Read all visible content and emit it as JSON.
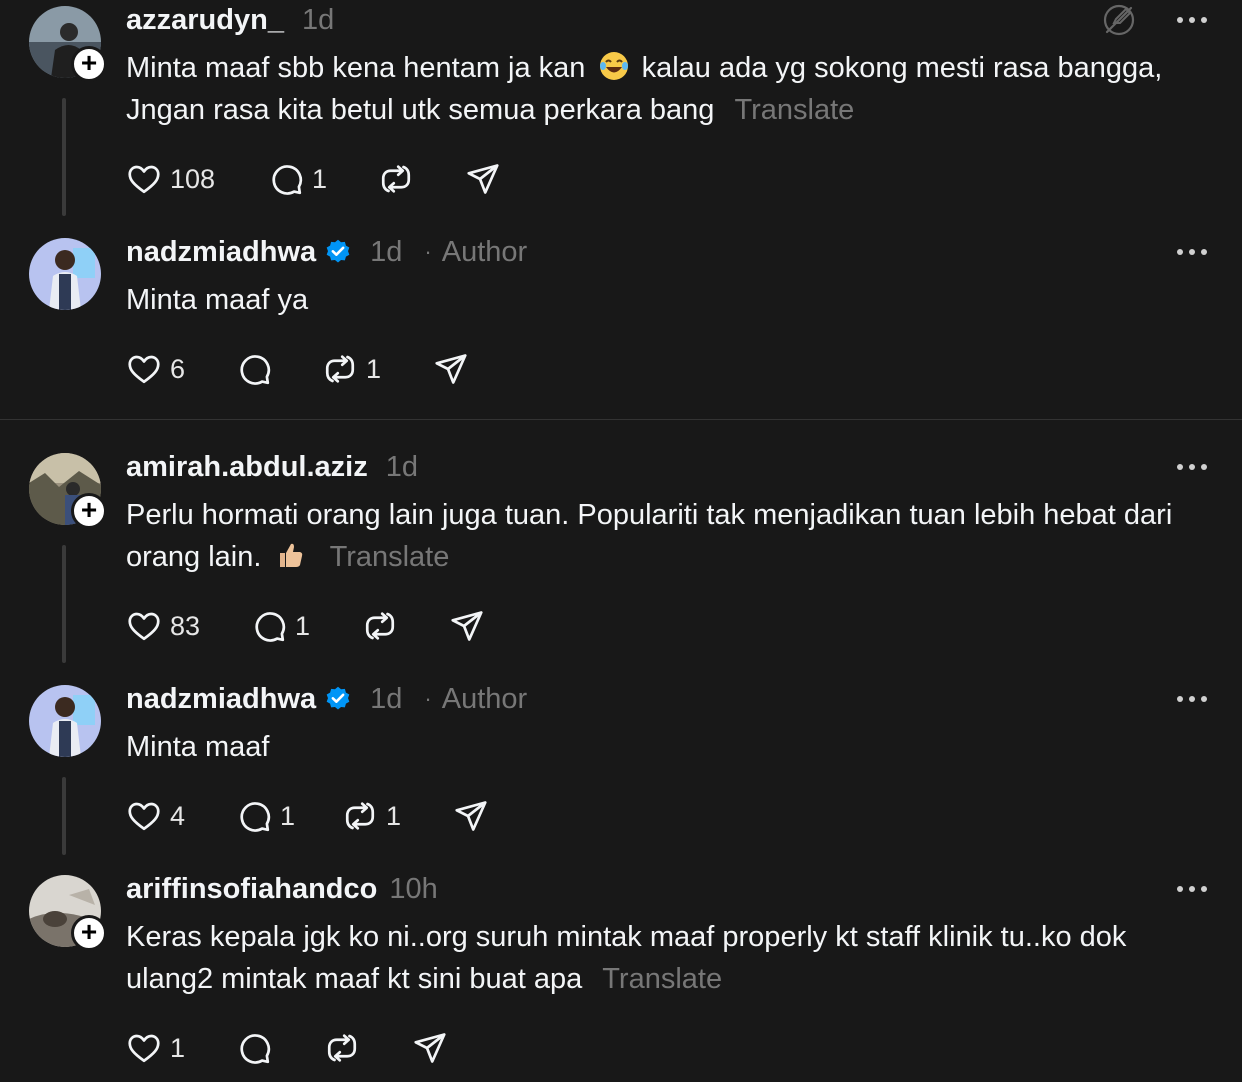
{
  "translate_label": "Translate",
  "author_label": "Author",
  "dot_sep": "·",
  "comments": [
    {
      "username": "azzarudyn_",
      "time": "1d",
      "text_a": "Minta maaf sbb kena hentam ja kan",
      "text_b": "kalau ada yg sokong mesti rasa bangga, Jngan rasa kita betul utk semua perkara bang",
      "likes": "108",
      "replies": "1",
      "reposts": ""
    },
    {
      "username": "nadzmiadhwa",
      "time": "1d",
      "text": "Minta maaf ya",
      "likes": "6",
      "replies": "",
      "reposts": "1"
    },
    {
      "username": "amirah.abdul.aziz",
      "time": "1d",
      "text": "Perlu hormati orang lain juga tuan. Populariti tak menjadikan tuan lebih hebat dari orang lain.",
      "likes": "83",
      "replies": "1",
      "reposts": ""
    },
    {
      "username": "nadzmiadhwa",
      "time": "1d",
      "text": "Minta maaf",
      "likes": "4",
      "replies": "1",
      "reposts": "1"
    },
    {
      "username": "ariffinsofiahandco",
      "time": "10h",
      "text": "Keras kepala jgk ko ni..org suruh mintak maaf properly kt staff klinik tu..ko dok ulang2 mintak maaf kt sini buat apa",
      "likes": "1",
      "replies": "",
      "reposts": ""
    }
  ]
}
